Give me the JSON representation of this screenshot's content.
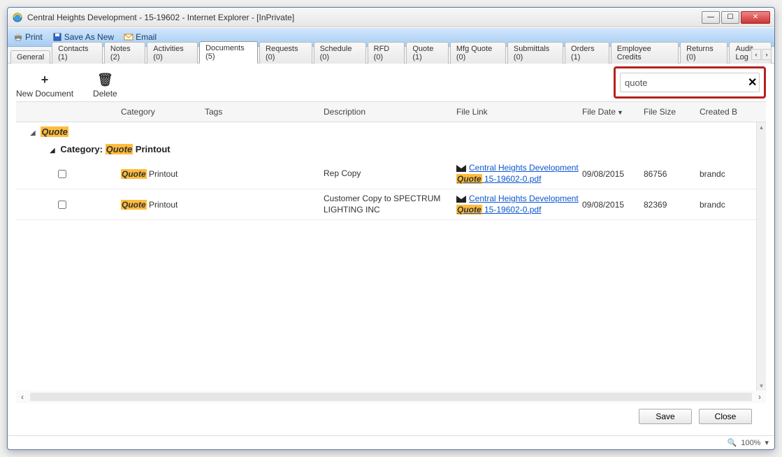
{
  "window": {
    "title": "Central Heights Development - 15-19602 - Internet Explorer - [InPrivate]"
  },
  "toolbar": {
    "print": "Print",
    "saveAsNew": "Save As New",
    "email": "Email"
  },
  "tabs": [
    {
      "label": "General"
    },
    {
      "label": "Contacts (1)"
    },
    {
      "label": "Notes (2)"
    },
    {
      "label": "Activities (0)"
    },
    {
      "label": "Documents (5)",
      "active": true
    },
    {
      "label": "Requests (0)"
    },
    {
      "label": "Schedule (0)"
    },
    {
      "label": "RFD (0)"
    },
    {
      "label": "Quote (1)"
    },
    {
      "label": "Mfg Quote (0)"
    },
    {
      "label": "Submittals (0)"
    },
    {
      "label": "Orders (1)"
    },
    {
      "label": "Employee Credits"
    },
    {
      "label": "Returns (0)"
    },
    {
      "label": "Audit Log"
    }
  ],
  "actions": {
    "newDoc": "New Document",
    "delete": "Delete"
  },
  "search": {
    "value": "quote"
  },
  "columns": {
    "category": "Category",
    "tags": "Tags",
    "description": "Description",
    "fileLink": "File Link",
    "fileDate": "File Date",
    "fileSize": "File Size",
    "createdBy": "Created B"
  },
  "groups": {
    "group1_hl": "Quote",
    "group2_prefix": "Category: ",
    "group2_hl": "Quote",
    "group2_suffix": " Printout"
  },
  "rows": [
    {
      "cat_hl": "Quote",
      "cat_rest": " Printout",
      "desc": "Rep Copy",
      "link_line1": "Central Heights Development",
      "link_hl": "Quote",
      "link_rest": " 15-19602-0.pdf",
      "date": "09/08/2015",
      "size": "86756",
      "created": "brandc"
    },
    {
      "cat_hl": "Quote",
      "cat_rest": " Printout",
      "desc": "Customer Copy to SPECTRUM LIGHTING INC",
      "link_line1": "Central Heights Development",
      "link_hl": "Quote",
      "link_rest": " 15-19602-0.pdf",
      "date": "09/08/2015",
      "size": "82369",
      "created": "brandc"
    }
  ],
  "footer": {
    "save": "Save",
    "close": "Close"
  },
  "status": {
    "zoom": "100%"
  }
}
